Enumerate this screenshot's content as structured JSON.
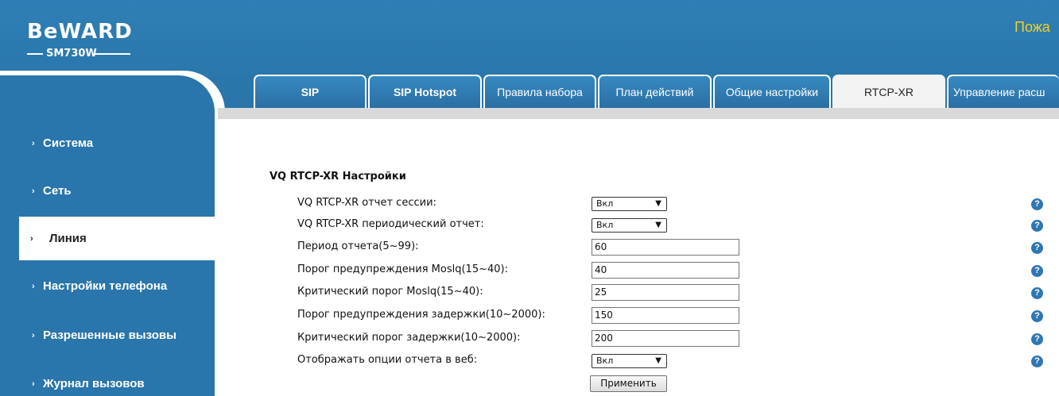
{
  "brand": {
    "logo": "BeWARD",
    "model": "SM730W",
    "welcome": "Пожа"
  },
  "tabs": [
    {
      "label": "SIP",
      "active": false
    },
    {
      "label": "SIP Hotspot",
      "active": false
    },
    {
      "label": "Правила набора",
      "active": false
    },
    {
      "label": "План действий",
      "active": false
    },
    {
      "label": "Общие настройки",
      "active": false
    },
    {
      "label": "RTCP-XR",
      "active": true
    },
    {
      "label": "Управление расш",
      "active": false
    }
  ],
  "sidebar": {
    "items": [
      {
        "label": "Система"
      },
      {
        "label": "Сеть"
      },
      {
        "label": "Линия",
        "active": true
      },
      {
        "label": "Настройки телефона"
      },
      {
        "label": "Разрешенные вызовы"
      },
      {
        "label": "Журнал вызовов"
      }
    ]
  },
  "form": {
    "title": "VQ RTCP-XR Настройки",
    "rows": [
      {
        "label": "VQ RTCP-XR отчет сессии:",
        "type": "select",
        "value": "Вкл"
      },
      {
        "label": "VQ RTCP-XR периодический отчет:",
        "type": "select",
        "value": "Вкл"
      },
      {
        "label": "Период отчета(5~99):",
        "type": "input",
        "value": "60"
      },
      {
        "label": "Порог предупреждения Moslq(15~40):",
        "type": "input",
        "value": "40"
      },
      {
        "label": "Критический порог Moslq(15~40):",
        "type": "input",
        "value": "25"
      },
      {
        "label": "Порог предупреждения задержки(10~2000):",
        "type": "input",
        "value": "150"
      },
      {
        "label": "Критический порог задержки(10~2000):",
        "type": "input",
        "value": "200"
      },
      {
        "label": "Отображать опции отчета в веб:",
        "type": "select",
        "value": "Вкл"
      }
    ],
    "help_glyph": "?",
    "apply_label": "Применить"
  },
  "colors": {
    "primary": "#2a75ab",
    "accent_text": "#f5d020",
    "help": "#2f76b2"
  }
}
